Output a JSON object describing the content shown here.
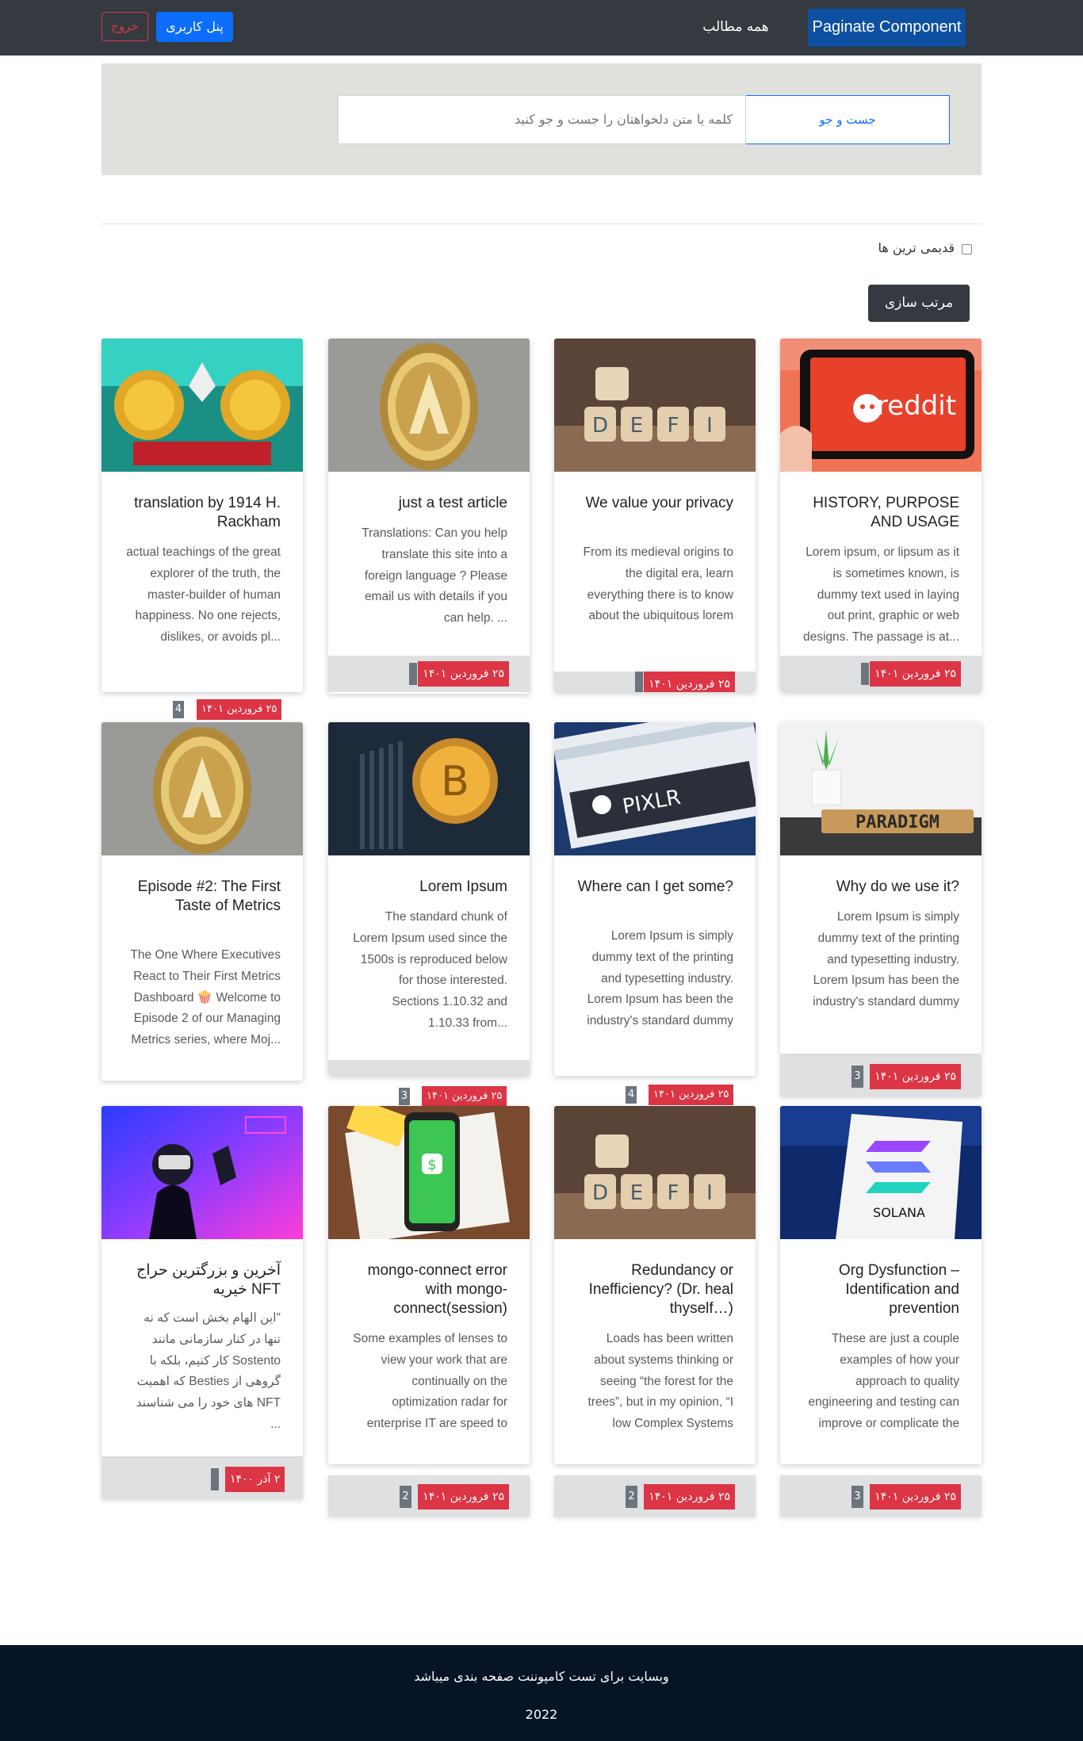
{
  "nav": {
    "brand": "Paginate Component",
    "all_posts": "همه مطالب",
    "user_panel": "پنل کاربری",
    "logout": "خروج"
  },
  "search": {
    "button": "جست و جو",
    "placeholder": "کلمه یا متن دلخواهتان را جست و جو کنید"
  },
  "filter": {
    "oldest_label": "قدیمی ترین ها",
    "oldest_checked": false
  },
  "sort_button": "مرتب سازی",
  "cards": [
    {
      "image": "reddit",
      "title": "HISTORY, PURPOSE AND USAGE",
      "body": "Lorem ipsum, or lipsum as it is sometimes known, is dummy text used in laying out print, graphic or web designs. The passage is at...",
      "date": "۲۵ فروردین ۱۴۰۱",
      "count": ""
    },
    {
      "image": "defi-dice",
      "title": "We value your privacy",
      "body": "From its medieval origins to the digital era, learn everything there is to know about the ubiquitous lorem ipsum passage....",
      "date": "۲۵ فروردین ۱۴۰۱",
      "count": ""
    },
    {
      "image": "coin-gold",
      "title": "just a test article",
      "body": "Translations: Can you help translate this site into a foreign language ? Please email us with details if you can help. ...",
      "date": "۲۵ فروردین ۱۴۰۱",
      "count": ""
    },
    {
      "image": "crypto-fight",
      "title": "translation by 1914 H. Rackham",
      "body": "actual teachings of the great explorer of the truth, the master-builder of human happiness. No one rejects, dislikes, or avoids pl...",
      "date": "۲۵ فروردین ۱۴۰۱",
      "count": "4"
    },
    {
      "image": "paradigm",
      "title": "Why do we use it?",
      "body": "Lorem Ipsum is simply dummy text of the printing and typesetting industry. Lorem Ipsum has been the industry's standard dummy text...",
      "date": "۲۵ فروردین ۱۴۰۱",
      "count": "3"
    },
    {
      "image": "pixlr",
      "title": "Where can I get some?",
      "body": "Lorem Ipsum is simply dummy text of the printing and typesetting industry. Lorem Ipsum has been the industry's standard dummy text...",
      "date": "۲۵ فروردین ۱۴۰۱",
      "count": "4"
    },
    {
      "image": "bitcoin",
      "title": "Lorem Ipsum",
      "body": "The standard chunk of Lorem Ipsum used since the 1500s is reproduced below for those interested. Sections 1.10.32 and 1.10.33 from...",
      "date": "۲۵ فروردین ۱۴۰۱",
      "count": "3"
    },
    {
      "image": "coin-gold",
      "title": "Episode #2: The First Taste of Metrics",
      "body": "The One Where Executives React to Their First Metrics Dashboard 🍿 Welcome to Episode 2 of our Managing Metrics series, where Moj...",
      "date": "",
      "count": ""
    },
    {
      "image": "solana",
      "title": "Org Dysfunction – Identification and prevention",
      "body": "These are just a couple examples of how your approach to quality engineering and testing can improve or complicate the optimizatio...",
      "date": "۲۵ فروردین ۱۴۰۱",
      "count": "3"
    },
    {
      "image": "defi-dice",
      "title": "Redundancy or Inefficiency? (Dr. heal thyself…)",
      "body": "Loads has been written about systems thinking or seeing “the forest for the trees”, but in my opinion, “I low Complex Systems Fail”...",
      "date": "۲۵ فروردین ۱۴۰۱",
      "count": "2"
    },
    {
      "image": "cash-app",
      "title": "mongo-connect error with mongo-connect(session)",
      "body": "Some examples of lenses to view your work that are continually on the optimization radar for enterprise IT are speed to market and...",
      "date": "۲۵ فروردین ۱۴۰۱",
      "count": "2"
    },
    {
      "image": "vr-man",
      "title": "آخرین و بزرگترین حراج خیریه NFT",
      "body": "\"این الهام بخش است که نه تنها در کنار سازمانی مانند Sostento کار کنیم، بلکه با گروهی از Besties که اهمیت NFT های خود را می شناسند ...",
      "date": "۲ آذر ۱۴۰۰",
      "count": ""
    }
  ],
  "footer": {
    "text": "وبسایت برای تست کامپوننت صفحه بندی میباشد",
    "year": "2022"
  }
}
